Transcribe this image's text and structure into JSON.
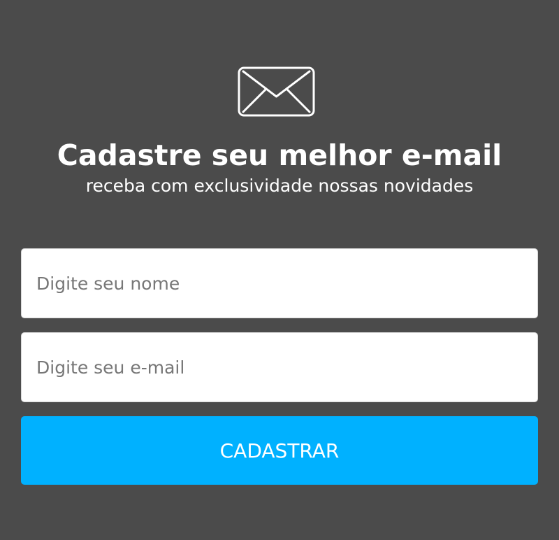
{
  "form": {
    "icon": "mail-envelope-icon",
    "title": "Cadastre seu melhor e-mail",
    "subtitle": "receba com exclusividade nossas novidades",
    "name_placeholder": "Digite seu nome",
    "name_value": "",
    "email_placeholder": "Digite seu e-mail",
    "email_value": "",
    "submit_label": "CADASTRAR"
  },
  "colors": {
    "background": "#4b4b4b",
    "input_background": "#ffffff",
    "input_border": "#d7d7d7",
    "placeholder": "#777777",
    "button": "#00b1ff",
    "text_light": "#ffffff"
  }
}
